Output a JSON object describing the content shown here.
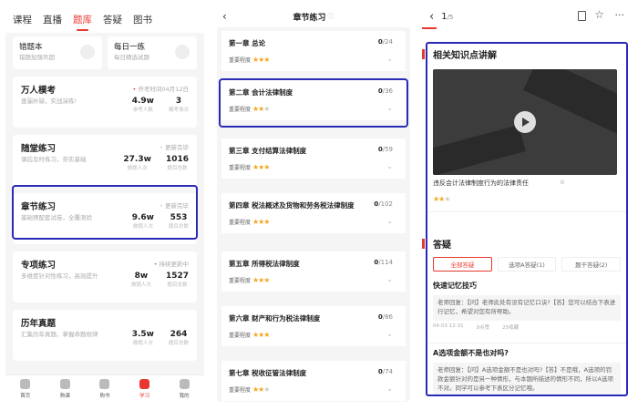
{
  "panel1": {
    "tabs": [
      "课程",
      "直播",
      "题库",
      "答疑",
      "图书"
    ],
    "active_tab": 2,
    "quick": [
      {
        "title": "错题本",
        "sub": "错题加强巩固"
      },
      {
        "title": "每日一练",
        "sub": "每日精选试题"
      }
    ],
    "cards": [
      {
        "title": "万人模考",
        "desc": "查漏补缺，实战演练!",
        "status": "开考时间04月12日",
        "n1": "4.9w",
        "l1": "参考人数",
        "n2": "3",
        "l2": "模考场次"
      },
      {
        "title": "随堂练习",
        "desc": "课后及时练习，夯实基础",
        "status": "更新完毕",
        "n1": "27.3w",
        "l1": "做题人次",
        "n2": "1016",
        "l2": "题目总数"
      },
      {
        "title": "章节练习",
        "desc": "基础预配套试卷，全覆测验",
        "status": "更新完毕",
        "n1": "9.6w",
        "l1": "做题人次",
        "n2": "553",
        "l2": "题目总数"
      },
      {
        "title": "专项练习",
        "desc": "多维度针对性练习，高效提升",
        "status": "持续更新中",
        "n1": "8w",
        "l1": "做题人次",
        "n2": "1527",
        "l2": "题目总数"
      },
      {
        "title": "历年真题",
        "desc": "汇集历年真题，掌握命题规律",
        "status": "",
        "n1": "3.5w",
        "l1": "做题人次",
        "n2": "264",
        "l2": "题目总数"
      }
    ],
    "bottom_tabs": [
      "首页",
      "购课",
      "购书",
      "学习",
      "我的"
    ]
  },
  "panel2": {
    "title": "章节练习",
    "importance_label": "重要程度",
    "chapters": [
      {
        "name": "第一章  总论",
        "done": "0",
        "total": "/24",
        "stars": 3
      },
      {
        "name": "第二章  会计法律制度",
        "done": "0",
        "total": "/36",
        "stars": 2
      },
      {
        "name": "第三章  支付结算法律制度",
        "done": "0",
        "total": "/59",
        "stars": 3
      },
      {
        "name": "第四章  税法概述及货物和劳务税法律制度",
        "done": "0",
        "total": "/102",
        "stars": 3
      },
      {
        "name": "第五章  所得税法律制度",
        "done": "0",
        "total": "/114",
        "stars": 3
      },
      {
        "name": "第六章  财产和行为税法律制度",
        "done": "0",
        "total": "/86",
        "stars": 3
      },
      {
        "name": "第七章  税收征管法律制度",
        "done": "0",
        "total": "/74",
        "stars": 2
      }
    ]
  },
  "panel3": {
    "page": "1",
    "page_total": "/5",
    "knowledge_title": "相关知识点讲解",
    "video_caption": "违反会计法律制度行为的法律责任",
    "qa_title": "答疑",
    "filters": [
      "全部答疑",
      "选项A答疑(1)",
      "题干答疑(2)"
    ],
    "questions": [
      {
        "title": "快速记忆技巧",
        "answer": "老师回复：【问】老师此处有没有记忆口诀?【答】您可以结合下表进行记忆，希望对您有所帮助。",
        "date": "04-03 12:31",
        "views": "9点赞",
        "replies": "25收藏"
      },
      {
        "title": "A选项金额不是也对吗?",
        "answer": "老师回复：【问】A选项金额不是也对吗?【答】不是哦，A选项的罚款金额针对的是另一种情形，与本题所描述的情形不同，所以A选项不对。同学可以参考下表区分记忆哦。"
      }
    ]
  },
  "colors": {
    "accent": "#e8382f",
    "highlight": "#2a2ab8",
    "star": "#f5a623"
  }
}
